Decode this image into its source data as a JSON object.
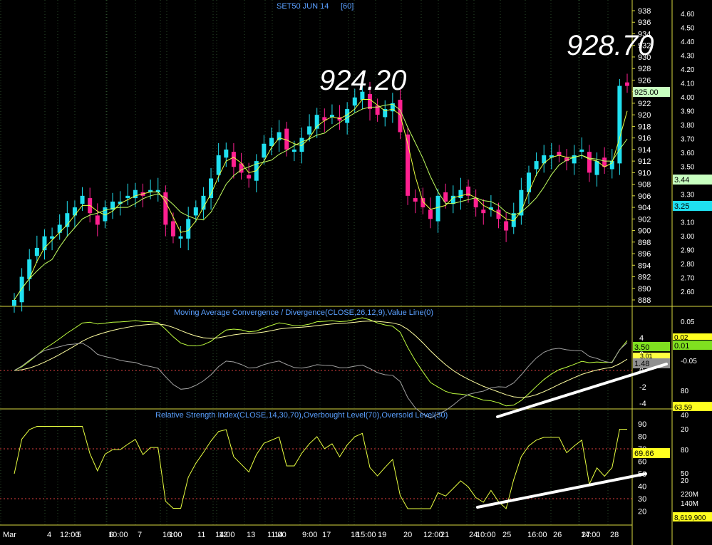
{
  "title": "SET50 JUN 14",
  "interval": "[60]",
  "price_panel": {
    "axis_ticks": [
      938,
      936,
      934,
      932,
      930,
      928,
      926,
      924,
      922,
      920,
      918,
      916,
      914,
      912,
      910,
      908,
      906,
      904,
      902,
      900,
      898,
      896,
      894,
      892,
      890,
      888
    ],
    "right_axis_ticks": [
      "4.60",
      "4.50",
      "4.40",
      "4.30",
      "4.20",
      "4.10",
      "4.00",
      "3.90",
      "3.80",
      "3.70",
      "3.60",
      "3.50",
      "3.40",
      "3.30",
      "3.20",
      "3.10",
      "3.00",
      "2.90",
      "2.80",
      "2.70",
      "2.60"
    ],
    "last_price_label": "925.00",
    "right_marker_1": "3.44",
    "right_marker_2": "3.25",
    "annotation_peak_1": "924.20",
    "annotation_peak_2": "928.70"
  },
  "macd_panel": {
    "title": "Moving Average Convergence / Divergence(CLOSE,26,12,9),Value Line(0)",
    "axis_ticks": [
      "4",
      "2",
      "0",
      "-2",
      "-4"
    ],
    "right_axis_ticks": [
      "0.05",
      "-0.05",
      "80",
      "40"
    ],
    "label_macd": "3.50",
    "label_signal": "3.01",
    "label_hist": "1.48",
    "label_right_a": "0.02",
    "label_right_b": "0.01",
    "label_right_c": "63.59"
  },
  "rsi_panel": {
    "title": "Relative Strength Index(CLOSE,14,30,70),Overbought Level(70),Oversold Level(30)",
    "axis_ticks": [
      "90",
      "80",
      "70",
      "60",
      "50",
      "40",
      "30",
      "20"
    ],
    "right_axis_ticks": [
      "20",
      "80",
      "50",
      "20",
      "220M",
      "140M"
    ],
    "label_rsi": "69.66",
    "label_volume": "8,619,900"
  },
  "x_axis_labels": [
    "Mar",
    "4",
    "12:00",
    "5",
    "10:00",
    "6",
    "7",
    "16:00",
    "10",
    "11",
    "14:00",
    "12",
    "13",
    "11:00",
    "14",
    "9:00",
    "17",
    "18",
    "15:00",
    "19",
    "20",
    "12:00",
    "21",
    "24",
    "10:00",
    "25",
    "16:00",
    "26",
    "27",
    "14:00",
    "28"
  ],
  "chart_data": {
    "type": "candlestick",
    "title": "SET50 JUN 14 [60]",
    "ylim": [
      887,
      939
    ],
    "series": [
      {
        "name": "close",
        "values": [
          888,
          892,
          895,
          897,
          899,
          899,
          901,
          903,
          904,
          906,
          903,
          901,
          904,
          905,
          905,
          906,
          907,
          906,
          907,
          907,
          901,
          899,
          899,
          902,
          904,
          906,
          909,
          913,
          914,
          911,
          910,
          909,
          912,
          915,
          916,
          917,
          914,
          914,
          916,
          918,
          920,
          919,
          920,
          919,
          921,
          923,
          924,
          921,
          920,
          921,
          922,
          917,
          906,
          905,
          904,
          902,
          906,
          905,
          906,
          907,
          906,
          904,
          903,
          904,
          902,
          900,
          903,
          907,
          910,
          912,
          913,
          913,
          913,
          912,
          913,
          914,
          910,
          912,
          911,
          912,
          925,
          925
        ]
      }
    ],
    "rsi": {
      "ylim": [
        15,
        95
      ],
      "overbought": 70,
      "oversold": 30,
      "last": 69.66
    },
    "macd": {
      "ylim": [
        -4.5,
        5
      ],
      "macd_last": 3.5,
      "signal_last": 3.01
    }
  }
}
